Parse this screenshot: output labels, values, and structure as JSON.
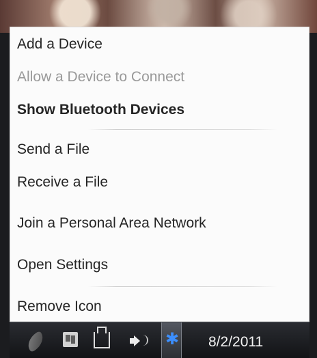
{
  "menu": {
    "items": [
      {
        "label": "Add a Device",
        "enabled": true,
        "bold": false
      },
      {
        "label": "Allow a Device to Connect",
        "enabled": false,
        "bold": false
      },
      {
        "label": "Show Bluetooth Devices",
        "enabled": true,
        "bold": true
      },
      {
        "label": "Send a File",
        "enabled": true,
        "bold": false
      },
      {
        "label": "Receive a File",
        "enabled": true,
        "bold": false
      },
      {
        "label": "Join a Personal Area Network",
        "enabled": true,
        "bold": false
      },
      {
        "label": "Open Settings",
        "enabled": true,
        "bold": false
      },
      {
        "label": "Remove Icon",
        "enabled": true,
        "bold": false
      }
    ]
  },
  "taskbar": {
    "date": "8/2/2011",
    "icons": [
      {
        "name": "leaf-icon"
      },
      {
        "name": "flag-icon"
      },
      {
        "name": "network-icon"
      },
      {
        "name": "speaker-icon"
      },
      {
        "name": "bluetooth-icon",
        "glyph": "✱"
      }
    ]
  },
  "colors": {
    "menu_background": "#fbfbfb",
    "menu_text": "#252525",
    "disabled_text": "#999999",
    "taskbar_background": "#1b1c1f",
    "bluetooth_blue": "#3c8fff"
  }
}
